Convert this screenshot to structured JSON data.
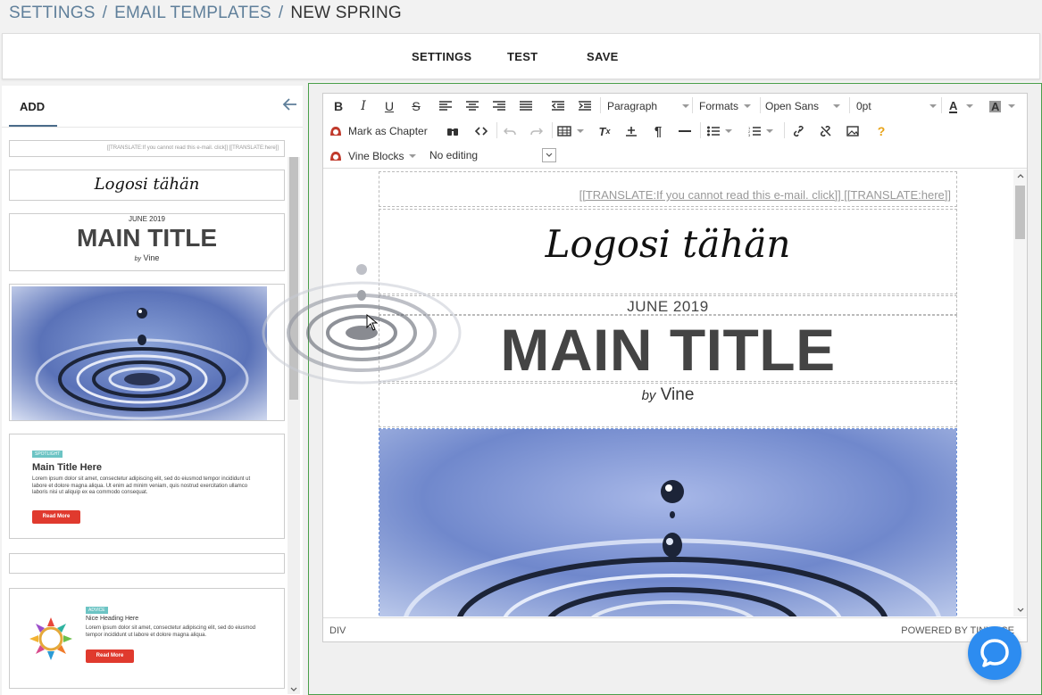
{
  "breadcrumb": {
    "items": [
      "SETTINGS",
      "EMAIL TEMPLATES"
    ],
    "separator": "/",
    "current": "NEW SPRING"
  },
  "topbar": {
    "settings_label": "SETTINGS",
    "test_label": "TEST",
    "save_label": "SAVE"
  },
  "panel": {
    "tab_add": "ADD"
  },
  "blocks": {
    "translate_text": "[[TRANSLATE:If you cannot read this e-mail. click]] [[TRANSLATE:here]]",
    "logo_text": "Logosi tähän",
    "date_text": "JUNE 2019",
    "title_text": "MAIN TITLE",
    "by_text": "by",
    "vine_text": "Vine",
    "spotlight": {
      "badge": "SPOTLIGHT",
      "title": "Main Title Here",
      "body": "Lorem ipsum dolor sit amet, consectetur adipiscing elit, sed do eiusmod tempor incididunt ut labore et dolore magna aliqua. Ut enim ad minim veniam, quis nostrud exercitation ullamco laboris nisi ut aliquip ex ea commodo consequat.",
      "button": "Read More"
    },
    "advice": {
      "badge": "ADVICE",
      "title": "Nice Heading Here",
      "body": "Lorem ipsum dolor sit amet, consectetur adipiscing elit, sed do eiusmod tempor incididunt ut labore et dolore magna aliqua.",
      "button": "Read More"
    }
  },
  "editor": {
    "toolbar": {
      "paragraph": "Paragraph",
      "formats": "Formats",
      "font": "Open Sans",
      "size": "0pt",
      "mark_chapter": "Mark as Chapter",
      "vine_blocks": "Vine Blocks",
      "no_editing": "No editing"
    },
    "content": {
      "translate_text": "[[TRANSLATE:If you cannot read this e-mail. click]] [[TRANSLATE:here]]",
      "logo_text": "Logosi tähän",
      "date_text": "JUNE 2019",
      "title_text": "MAIN TITLE",
      "by_text": "by",
      "vine_text": "Vine"
    },
    "status_path": "DIV",
    "powered_by": "POWERED BY TINYMCE"
  },
  "colors": {
    "accent_green": "#4aa04a",
    "chat_blue": "#2d8cf0",
    "read_more_red": "#e03a2e",
    "badge_teal": "#6cc4c4",
    "breadcrumb_blue": "#5f7f9a"
  }
}
